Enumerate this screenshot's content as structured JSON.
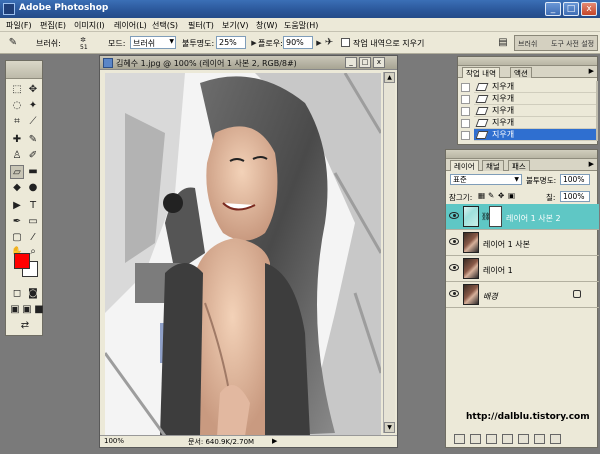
{
  "window": {
    "title": "Adobe Photoshop",
    "minimize": "_",
    "maximize": "□",
    "close": "x"
  },
  "menu": [
    "파일(F)",
    "편집(E)",
    "이미지(I)",
    "레이어(L)",
    "선택(S)",
    "필터(T)",
    "보기(V)",
    "창(W)",
    "도움말(H)"
  ],
  "options": {
    "brush_label": "브러쉬:",
    "brush_size": "51",
    "mode_label": "모드:",
    "mode_value": "브러쉬",
    "opacity_label": "불투명도:",
    "opacity_value": "25%",
    "flow_label": "플로우:",
    "flow_value": "90%",
    "history_erase_label": "작업 내역으로 지우기",
    "well_left": "브러쉬",
    "well_right": "도구 사전 설정"
  },
  "document": {
    "title": "김혜수 1.jpg @ 100% (레이어 1 사본 2, RGB/8#)",
    "zoom": "100%",
    "status": "문서: 640.9K/2.70M"
  },
  "history": {
    "tabs": [
      "작업 내역",
      "액션"
    ],
    "items": [
      "지우개",
      "지우개",
      "지우개",
      "지우개",
      "지우개"
    ],
    "selected_index": 4
  },
  "layers": {
    "tabs": [
      "레이어",
      "채널",
      "패스"
    ],
    "blend_mode": "표준",
    "opacity_label": "불투명도:",
    "opacity_value": "100%",
    "lock_label": "잠그기:",
    "fill_label": "칠:",
    "fill_value": "100%",
    "items": [
      "레이어 1 사본 2",
      "레이어 1 사본",
      "레이어 1",
      "배경"
    ],
    "selected_index": 0
  },
  "watermark": "http://dalblu.tistory.com",
  "colors": {
    "foreground": "#ff0000",
    "background": "#ffffff",
    "selection": "#2f6fd0",
    "layer_selection": "#5fc7c5"
  }
}
